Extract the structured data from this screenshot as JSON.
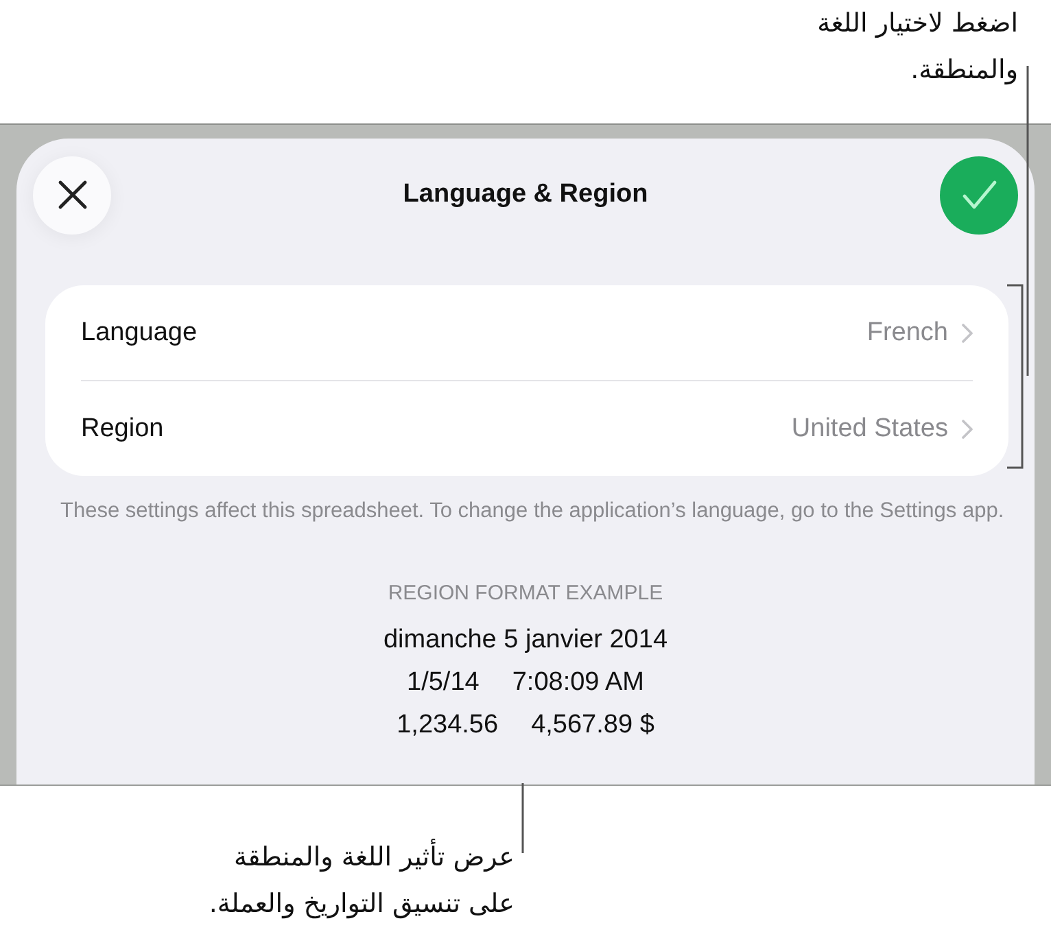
{
  "top_callout": {
    "lines": [
      "اضغط لاختيار اللغة",
      "والمنطقة."
    ]
  },
  "sheet": {
    "title": "Language & Region",
    "rows": [
      {
        "label": "Language",
        "value": "French"
      },
      {
        "label": "Region",
        "value": "United States"
      }
    ],
    "note": "These settings affect this spreadsheet. To change the application’s language, go to the Settings app.",
    "example": {
      "heading": "REGION FORMAT EXAMPLE",
      "lines": [
        [
          "dimanche 5 janvier 2014"
        ],
        [
          "1/5/14",
          "7:08:09 AM"
        ],
        [
          "1,234.56",
          "4,567.89 $"
        ]
      ]
    }
  },
  "bottom_callout": {
    "lines": [
      "عرض تأثير اللغة والمنطقة",
      "على تنسيق التواريخ والعملة."
    ]
  }
}
